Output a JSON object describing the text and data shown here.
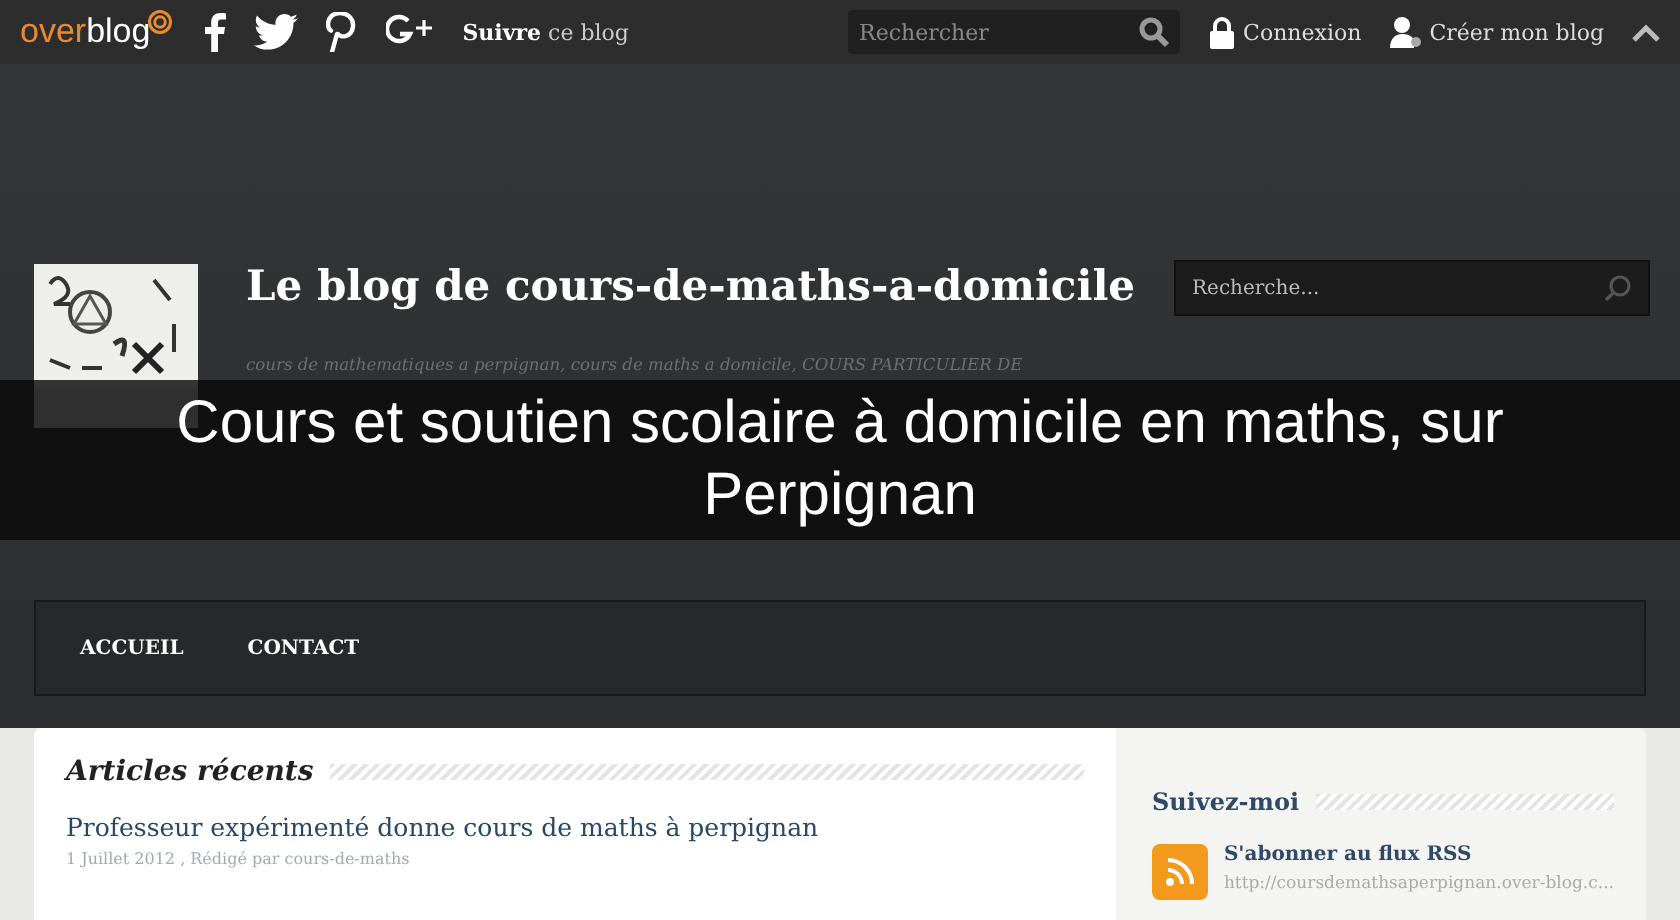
{
  "top_bar": {
    "logo": {
      "part1": "over",
      "part2": "blog"
    },
    "follow": {
      "bold": "Suivre",
      "rest": "ce blog"
    },
    "search": {
      "placeholder": "Rechercher"
    },
    "links": [
      {
        "label": "Connexion",
        "kind": "lock"
      },
      {
        "label": "Créer mon blog",
        "kind": "user"
      }
    ]
  },
  "header": {
    "title": "Le blog de cours-de-maths-a-domicile",
    "description": [
      "cours de mathematiques a perpignan, cours de maths a domicile, COURS PARTICULIER DE"
    ],
    "search": {
      "placeholder": "Recherche..."
    }
  },
  "banner": {
    "text": "Cours et soutien scolaire à domicile en maths, sur Perpignan"
  },
  "nav": [
    {
      "label": "ACCUEIL"
    },
    {
      "label": "CONTACT"
    }
  ],
  "main": {
    "heading": "Articles récents",
    "articles": [
      {
        "title": "Professeur expérimenté donne cours de maths à perpignan",
        "meta": "1 Juillet 2012 , Rédigé par cours-de-maths"
      }
    ]
  },
  "sidebar": {
    "heading": "Suivez-moi",
    "rss": {
      "title": "S'abonner au flux RSS",
      "url": "http://coursdemathsaperpignan.over-blog.c..."
    }
  }
}
